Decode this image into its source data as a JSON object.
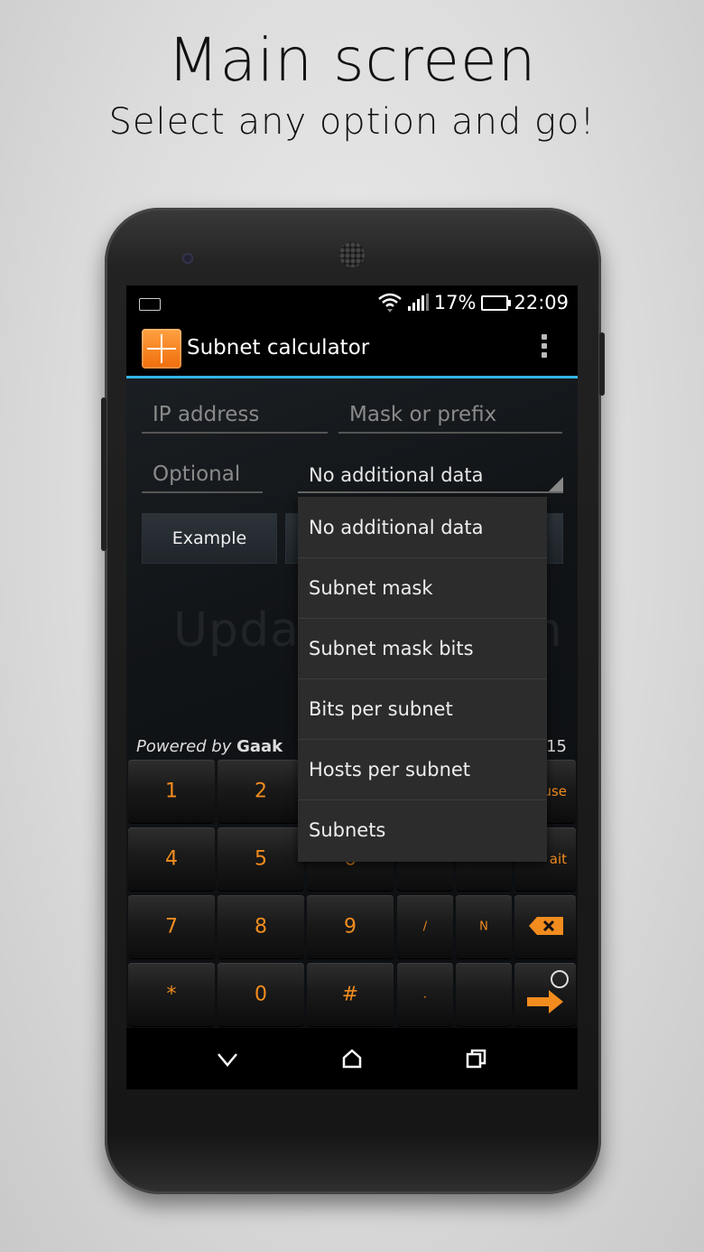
{
  "headline": {
    "title": "Main screen",
    "subtitle": "Select any option and go!"
  },
  "status_bar": {
    "battery_percent": "17%",
    "time": "22:09",
    "icons": [
      "keyboard-icon",
      "wifi-icon",
      "signal-icon",
      "battery-charging-icon"
    ]
  },
  "action_bar": {
    "title": "Subnet calculator",
    "icon": "subnet-calculator-app-icon",
    "overflow_icon": "overflow-menu-icon"
  },
  "form": {
    "ip_placeholder": "IP address",
    "mask_placeholder": "Mask or prefix",
    "optional_placeholder": "Optional",
    "spinner_value": "No additional data",
    "example_button": "Example"
  },
  "watermark": "UpdateStar.com",
  "footer": {
    "powered_prefix": "Powered by",
    "powered_name": "Gaak",
    "right_text": "15"
  },
  "dropdown": {
    "options": [
      "No additional data",
      "Subnet mask",
      "Subnet mask bits",
      "Bits per subnet",
      "Hosts per subnet",
      "Subnets"
    ]
  },
  "keypad": {
    "row1": [
      "1",
      "2",
      "",
      "",
      "",
      "use"
    ],
    "row2": [
      "4",
      "5",
      "6",
      "",
      "",
      "ait"
    ],
    "row3": [
      "7",
      "8",
      "9",
      "/",
      "N",
      ""
    ],
    "row4": [
      "*",
      "0",
      "#",
      ".",
      "",
      ""
    ]
  },
  "colors": {
    "accent": "#f28c1e",
    "holo_blue": "#33b5e5",
    "screen_bg": "#0b0d0f"
  },
  "nav_bar": {
    "icons": [
      "back-icon",
      "home-icon",
      "recents-icon"
    ]
  }
}
